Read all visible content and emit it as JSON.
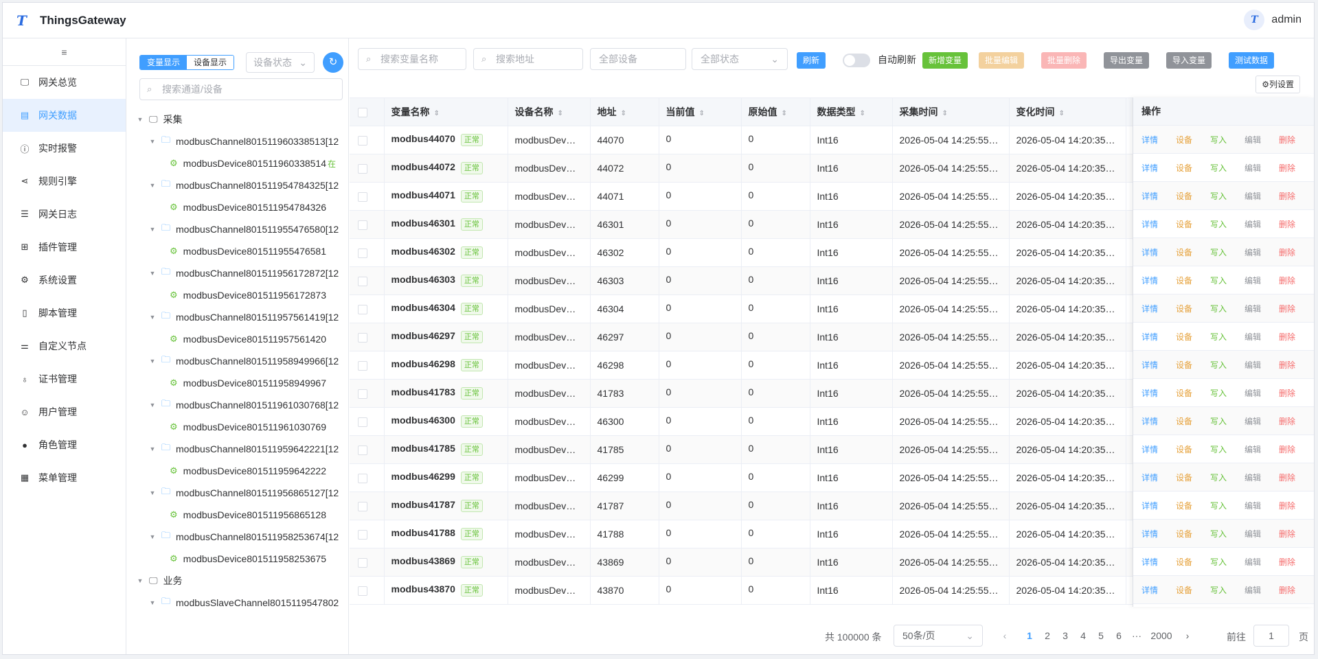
{
  "app": {
    "title": "ThingsGateway",
    "logo_letter": "T",
    "user": "admin"
  },
  "menu": {
    "collapse_icon": "≡",
    "items": [
      {
        "label": "网关总览",
        "icon": "monitor-icon"
      },
      {
        "label": "网关数据",
        "icon": "data-icon",
        "active": true
      },
      {
        "label": "实时报警",
        "icon": "alert-icon"
      },
      {
        "label": "规则引擎",
        "icon": "share-icon"
      },
      {
        "label": "网关日志",
        "icon": "log-icon"
      },
      {
        "label": "插件管理",
        "icon": "plugin-icon"
      },
      {
        "label": "系统设置",
        "icon": "gear-icon"
      },
      {
        "label": "脚本管理",
        "icon": "script-icon"
      },
      {
        "label": "自定义节点",
        "icon": "sliders-icon"
      },
      {
        "label": "证书管理",
        "icon": "cert-icon"
      },
      {
        "label": "用户管理",
        "icon": "user-icon"
      },
      {
        "label": "角色管理",
        "icon": "role-icon"
      },
      {
        "label": "菜单管理",
        "icon": "grid-icon"
      }
    ]
  },
  "tree_panel": {
    "seg_variable": "变量显示",
    "seg_device": "设备显示",
    "device_state_placeholder": "设备状态",
    "search_placeholder": "搜索通道/设备",
    "nodes": [
      {
        "level": 0,
        "type": "group",
        "label": "采集"
      },
      {
        "level": 1,
        "type": "channel",
        "label": "modbusChannel801511960338513[12"
      },
      {
        "level": 2,
        "type": "device",
        "label": "modbusDevice801511960338514",
        "status": "在"
      },
      {
        "level": 1,
        "type": "channel",
        "label": "modbusChannel801511954784325[12"
      },
      {
        "level": 2,
        "type": "device",
        "label": "modbusDevice801511954784326"
      },
      {
        "level": 1,
        "type": "channel",
        "label": "modbusChannel801511955476580[12"
      },
      {
        "level": 2,
        "type": "device",
        "label": "modbusDevice801511955476581"
      },
      {
        "level": 1,
        "type": "channel",
        "label": "modbusChannel801511956172872[12"
      },
      {
        "level": 2,
        "type": "device",
        "label": "modbusDevice801511956172873"
      },
      {
        "level": 1,
        "type": "channel",
        "label": "modbusChannel801511957561419[12"
      },
      {
        "level": 2,
        "type": "device",
        "label": "modbusDevice801511957561420"
      },
      {
        "level": 1,
        "type": "channel",
        "label": "modbusChannel801511958949966[12"
      },
      {
        "level": 2,
        "type": "device",
        "label": "modbusDevice801511958949967"
      },
      {
        "level": 1,
        "type": "channel",
        "label": "modbusChannel801511961030768[12"
      },
      {
        "level": 2,
        "type": "device",
        "label": "modbusDevice801511961030769"
      },
      {
        "level": 1,
        "type": "channel",
        "label": "modbusChannel801511959642221[12"
      },
      {
        "level": 2,
        "type": "device",
        "label": "modbusDevice801511959642222"
      },
      {
        "level": 1,
        "type": "channel",
        "label": "modbusChannel801511956865127[12"
      },
      {
        "level": 2,
        "type": "device",
        "label": "modbusDevice801511956865128"
      },
      {
        "level": 1,
        "type": "channel",
        "label": "modbusChannel801511958253674[12"
      },
      {
        "level": 2,
        "type": "device",
        "label": "modbusDevice801511958253675"
      },
      {
        "level": 0,
        "type": "group",
        "label": "业务"
      },
      {
        "level": 1,
        "type": "channel",
        "label": "modbusSlaveChannel8015119547802"
      }
    ]
  },
  "toolbar": {
    "search_var": "搜索变量名称",
    "search_addr": "搜索地址",
    "all_devices": "全部设备",
    "all_states": "全部状态",
    "refresh": "刷新",
    "auto_refresh": "自动刷新",
    "add_var": "新增变量",
    "batch_edit": "批量编辑",
    "batch_delete": "批量删除",
    "export_var": "导出变量",
    "import_var": "导入变量",
    "test_data": "测试数据",
    "col_settings": "⚙列设置"
  },
  "table": {
    "headers": [
      "变量名称",
      "设备名称",
      "地址",
      "当前值",
      "原始值",
      "数据类型",
      "采集时间",
      "变化时间"
    ],
    "ops_header": "操作",
    "ops": [
      "详情",
      "设备",
      "写入",
      "编辑",
      "删除"
    ],
    "status_label": "正常",
    "rows": [
      [
        "modbus44070",
        "modbusDev…",
        "44070",
        "0",
        "0",
        "Int16",
        "2026-05-04 14:25:55…",
        "2026-05-04 14:20:35…"
      ],
      [
        "modbus44072",
        "modbusDev…",
        "44072",
        "0",
        "0",
        "Int16",
        "2026-05-04 14:25:55…",
        "2026-05-04 14:20:35…"
      ],
      [
        "modbus44071",
        "modbusDev…",
        "44071",
        "0",
        "0",
        "Int16",
        "2026-05-04 14:25:55…",
        "2026-05-04 14:20:35…"
      ],
      [
        "modbus46301",
        "modbusDev…",
        "46301",
        "0",
        "0",
        "Int16",
        "2026-05-04 14:25:55…",
        "2026-05-04 14:20:35…"
      ],
      [
        "modbus46302",
        "modbusDev…",
        "46302",
        "0",
        "0",
        "Int16",
        "2026-05-04 14:25:55…",
        "2026-05-04 14:20:35…"
      ],
      [
        "modbus46303",
        "modbusDev…",
        "46303",
        "0",
        "0",
        "Int16",
        "2026-05-04 14:25:55…",
        "2026-05-04 14:20:35…"
      ],
      [
        "modbus46304",
        "modbusDev…",
        "46304",
        "0",
        "0",
        "Int16",
        "2026-05-04 14:25:55…",
        "2026-05-04 14:20:35…"
      ],
      [
        "modbus46297",
        "modbusDev…",
        "46297",
        "0",
        "0",
        "Int16",
        "2026-05-04 14:25:55…",
        "2026-05-04 14:20:35…"
      ],
      [
        "modbus46298",
        "modbusDev…",
        "46298",
        "0",
        "0",
        "Int16",
        "2026-05-04 14:25:55…",
        "2026-05-04 14:20:35…"
      ],
      [
        "modbus41783",
        "modbusDev…",
        "41783",
        "0",
        "0",
        "Int16",
        "2026-05-04 14:25:55…",
        "2026-05-04 14:20:35…"
      ],
      [
        "modbus46300",
        "modbusDev…",
        "46300",
        "0",
        "0",
        "Int16",
        "2026-05-04 14:25:55…",
        "2026-05-04 14:20:35…"
      ],
      [
        "modbus41785",
        "modbusDev…",
        "41785",
        "0",
        "0",
        "Int16",
        "2026-05-04 14:25:55…",
        "2026-05-04 14:20:35…"
      ],
      [
        "modbus46299",
        "modbusDev…",
        "46299",
        "0",
        "0",
        "Int16",
        "2026-05-04 14:25:55…",
        "2026-05-04 14:20:35…"
      ],
      [
        "modbus41787",
        "modbusDev…",
        "41787",
        "0",
        "0",
        "Int16",
        "2026-05-04 14:25:55…",
        "2026-05-04 14:20:35…"
      ],
      [
        "modbus41788",
        "modbusDev…",
        "41788",
        "0",
        "0",
        "Int16",
        "2026-05-04 14:25:55…",
        "2026-05-04 14:20:35…"
      ],
      [
        "modbus43869",
        "modbusDev…",
        "43869",
        "0",
        "0",
        "Int16",
        "2026-05-04 14:25:55…",
        "2026-05-04 14:20:35…"
      ],
      [
        "modbus43870",
        "modbusDev…",
        "43870",
        "0",
        "0",
        "Int16",
        "2026-05-04 14:25:55…",
        "2026-05-04 14:20:35…"
      ]
    ]
  },
  "pagination": {
    "total": "共 100000 条",
    "page_size": "50条/页",
    "pages": [
      "1",
      "2",
      "3",
      "4",
      "5",
      "6",
      "···",
      "2000"
    ],
    "current": "1",
    "goto_label": "前往",
    "goto_value": "1",
    "page_word": "页"
  },
  "colors": {
    "primary": "#409eff",
    "success": "#67c23a",
    "warning": "#e6a23c",
    "danger": "#f56c6c",
    "info": "#909399"
  }
}
